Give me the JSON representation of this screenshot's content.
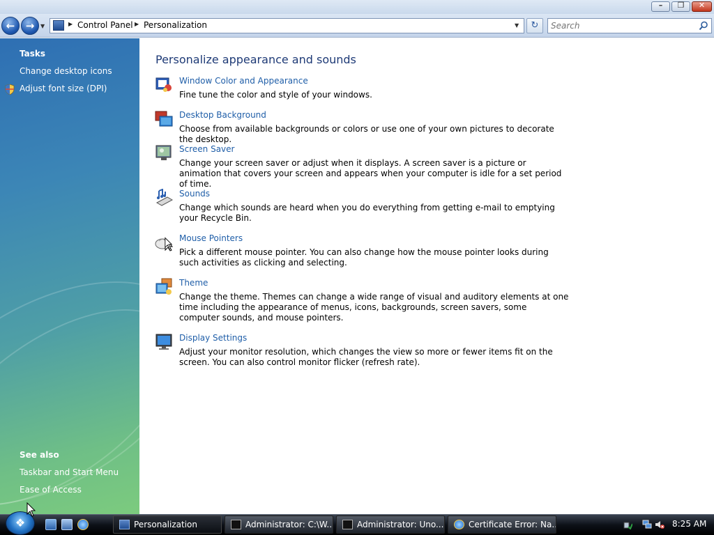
{
  "window": {
    "minimize": "–",
    "maximize": "❐",
    "close": "✕"
  },
  "navigation": {
    "back": "←",
    "forward": "→",
    "breadcrumbs": [
      "Control Panel",
      "Personalization"
    ],
    "refresh": "↻",
    "search_placeholder": "Search"
  },
  "sidebar": {
    "tasks_heading": "Tasks",
    "tasks": [
      "Change desktop icons",
      "Adjust font size (DPI)"
    ],
    "see_also_heading": "See also",
    "see_also": [
      "Taskbar and Start Menu",
      "Ease of Access"
    ]
  },
  "main": {
    "title": "Personalize appearance and sounds",
    "items": [
      {
        "icon": "window-color-icon",
        "title": "Window Color and Appearance",
        "description": "Fine tune the color and style of your windows."
      },
      {
        "icon": "desktop-background-icon",
        "title": "Desktop Background",
        "description": "Choose from available backgrounds or colors or use one of your own pictures to decorate the desktop."
      },
      {
        "icon": "screen-saver-icon",
        "title": "Screen Saver",
        "description": "Change your screen saver or adjust when it displays. A screen saver is a picture or animation that covers your screen and appears when your computer is idle for a set period of time."
      },
      {
        "icon": "sounds-icon",
        "title": "Sounds",
        "description": "Change which sounds are heard when you do everything from getting e-mail to emptying your Recycle Bin."
      },
      {
        "icon": "mouse-pointers-icon",
        "title": "Mouse Pointers",
        "description": "Pick a different mouse pointer. You can also change how the mouse pointer looks during such activities as clicking and selecting."
      },
      {
        "icon": "theme-icon",
        "title": "Theme",
        "description": "Change the theme. Themes can change a wide range of visual and auditory elements at one time including the appearance of menus, icons, backgrounds, screen savers, some computer sounds, and mouse pointers."
      },
      {
        "icon": "display-settings-icon",
        "title": "Display Settings",
        "description": "Adjust your monitor resolution, which changes the view so more or fewer items fit on the screen. You can also control monitor flicker (refresh rate)."
      }
    ]
  },
  "taskbar": {
    "buttons": [
      {
        "label": "Personalization",
        "icon": "control-panel-icon",
        "active": true
      },
      {
        "label": "Administrator: C:\\W...",
        "icon": "command-prompt-icon",
        "active": false
      },
      {
        "label": "Administrator:  Uno...",
        "icon": "command-prompt-icon",
        "active": false
      },
      {
        "label": "Certificate Error: Na...",
        "icon": "internet-explorer-icon",
        "active": false
      }
    ],
    "clock": "8:25 AM"
  },
  "colors": {
    "link": "#1f5ea8",
    "title": "#1e3a76",
    "sidebar_top": "#2e6fb3",
    "sidebar_bottom": "#7ccb7e"
  }
}
